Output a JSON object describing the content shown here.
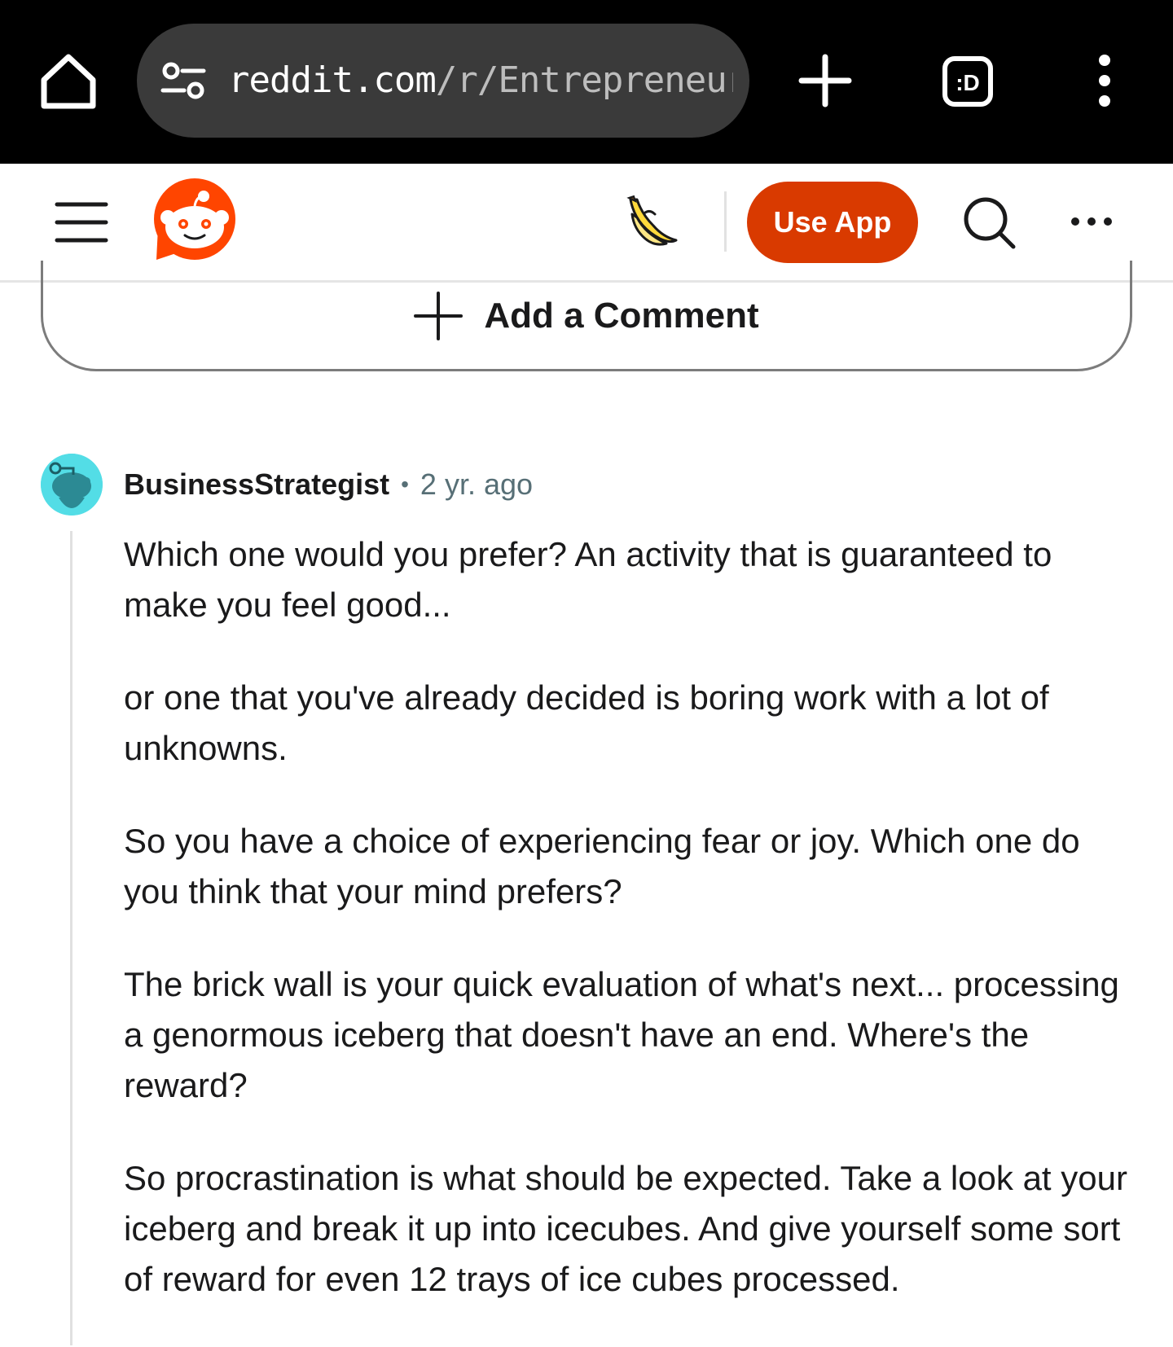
{
  "browser": {
    "url_host": "reddit.com",
    "url_path": "/r/Entrepreneur/",
    "tabs_icon_label": ":D"
  },
  "icons": {
    "home": "home-icon",
    "site_settings": "site-settings-icon",
    "new_tab": "plus-icon",
    "tabs": "tab-switcher-icon",
    "browser_menu": "kebab-menu-icon",
    "hamburger": "hamburger-menu-icon",
    "logo": "reddit-snoo-logo",
    "banana": "banana-icon",
    "search": "search-icon",
    "more": "more-horizontal-icon",
    "add": "plus-icon"
  },
  "header": {
    "use_app_label": "Use App"
  },
  "add_comment": {
    "label": "Add a Comment"
  },
  "comment": {
    "author": "BusinessStrategist",
    "separator": "•",
    "timestamp": "2 yr. ago",
    "paragraphs": [
      "Which one would you prefer? An activity that is guaranteed to make you feel good...",
      "or one that you've already decided is boring work with a lot of unknowns.",
      "So you have a choice of experiencing fear or joy. Which one do you think that your mind prefers?",
      "The brick wall is your quick evaluation of what's next... processing a genormous iceberg that doesn't have an end. Where's the reward?",
      "So procrastination is what should be expected. Take a look at your iceberg and break it up into icecubes. And give yourself some sort of reward for even 12 trays of ice cubes processed."
    ]
  },
  "colors": {
    "browser_bar": "#000000",
    "url_pill": "#3a3a3a",
    "accent": "#d93a00",
    "reddit_orange": "#ff4500",
    "avatar_bg": "#53dde6",
    "meta_text": "#576f76"
  }
}
